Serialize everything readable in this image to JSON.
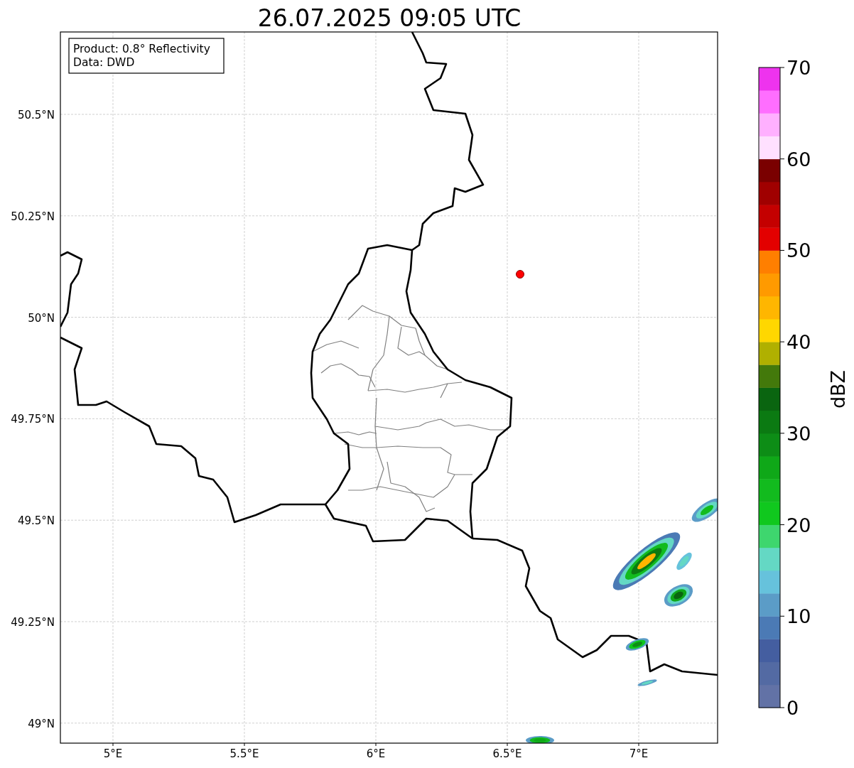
{
  "title": "26.07.2025 09:05 UTC",
  "info_box": [
    "Product: 0.8° Reflectivity",
    "Data: DWD"
  ],
  "x_ticks": [
    "5°E",
    "5.5°E",
    "6°E",
    "6.5°E",
    "7°E"
  ],
  "y_ticks": [
    "50.5°N",
    "50.25°N",
    "50°N",
    "49.75°N",
    "49.5°N",
    "49.25°N",
    "49°N"
  ],
  "colorbar": {
    "label": "dBZ",
    "ticks": [
      "70",
      "60",
      "50",
      "40",
      "30",
      "20",
      "10",
      "0"
    ],
    "colors": [
      {
        "color": "#6272a6"
      },
      {
        "color": "#536aa3"
      },
      {
        "color": "#445ea0"
      },
      {
        "color": "#4b7ab5"
      },
      {
        "color": "#5b9cc7"
      },
      {
        "color": "#66c2dc"
      },
      {
        "color": "#64d8c4"
      },
      {
        "color": "#3ed66e"
      },
      {
        "color": "#10c81e"
      },
      {
        "color": "#12bb1e"
      },
      {
        "color": "#0fa818"
      },
      {
        "color": "#0d8d16"
      },
      {
        "color": "#0b7a12"
      },
      {
        "color": "#0a6510"
      },
      {
        "color": "#43790b"
      },
      {
        "color": "#b0b000"
      },
      {
        "color": "#ffd700"
      },
      {
        "color": "#ffb600"
      },
      {
        "color": "#ff9a00"
      },
      {
        "color": "#ff7f00"
      },
      {
        "color": "#e30000"
      },
      {
        "color": "#c40000"
      },
      {
        "color": "#a00000"
      },
      {
        "color": "#7a0000"
      },
      {
        "color": "#ffe0ff"
      },
      {
        "color": "#ffb0ff"
      },
      {
        "color": "#ff6eff"
      },
      {
        "color": "#ee33ee"
      }
    ]
  }
}
